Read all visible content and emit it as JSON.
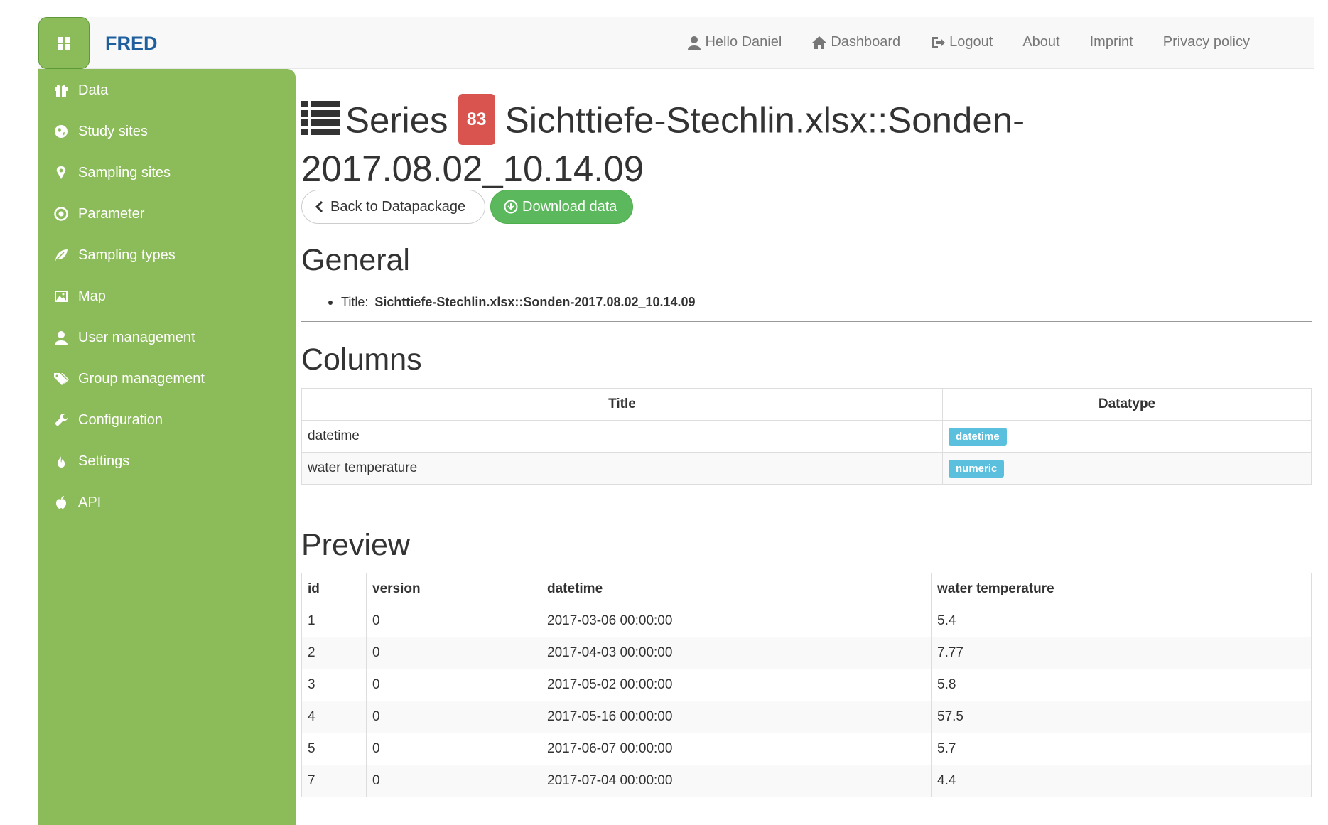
{
  "navbar": {
    "brand": "FRED",
    "links": [
      "Hello Daniel",
      "Dashboard",
      "Logout",
      "About",
      "Imprint",
      "Privacy policy"
    ]
  },
  "sidebar": {
    "items": [
      "Data",
      "Study sites",
      "Sampling sites",
      "Parameter",
      "Sampling types",
      "Map",
      "User management",
      "Group management",
      "Configuration",
      "Settings",
      "API"
    ]
  },
  "page": {
    "prefix": "Series",
    "badge": "83",
    "title_line1": "Sichttiefe-Stechlin.xlsx::Sonden-",
    "title_line2": "2017.08.02_10.14.09",
    "back_button": "Back to Datapackage",
    "download_button": "Download data"
  },
  "general": {
    "heading": "General",
    "title_label": "Title:",
    "title_value": "Sichttiefe-Stechlin.xlsx::Sonden-2017.08.02_10.14.09"
  },
  "columns": {
    "heading": "Columns",
    "headers": [
      "Title",
      "Datatype"
    ],
    "rows": [
      [
        "datetime",
        "datetime"
      ],
      [
        "water temperature",
        "numeric"
      ]
    ]
  },
  "preview": {
    "heading": "Preview",
    "headers": [
      "id",
      "version",
      "datetime",
      "water temperature"
    ],
    "rows": [
      [
        "1",
        "0",
        "2017-03-06 00:00:00",
        "5.4"
      ],
      [
        "2",
        "0",
        "2017-04-03 00:00:00",
        "7.77"
      ],
      [
        "3",
        "0",
        "2017-05-02 00:00:00",
        "5.8"
      ],
      [
        "4",
        "0",
        "2017-05-16 00:00:00",
        "57.5"
      ],
      [
        "5",
        "0",
        "2017-06-07 00:00:00",
        "5.7"
      ],
      [
        "7",
        "0",
        "2017-07-04 00:00:00",
        "4.4"
      ]
    ]
  }
}
